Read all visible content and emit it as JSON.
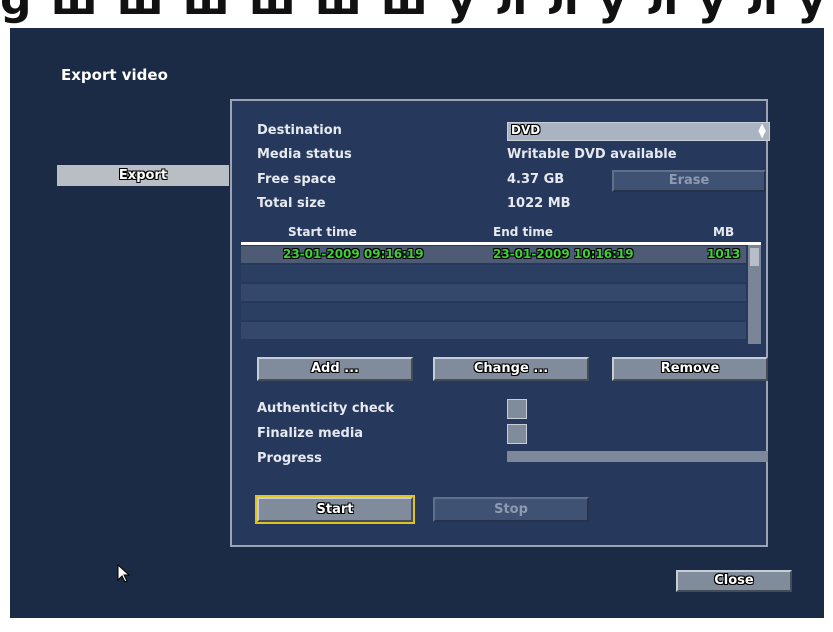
{
  "window": {
    "title": "Export video"
  },
  "sidebar": {
    "tab_label": "Export"
  },
  "form": {
    "destination_label": "Destination",
    "destination_value": "DVD",
    "media_status_label": "Media status",
    "media_status_value": "Writable DVD available",
    "free_space_label": "Free space",
    "free_space_value": "4.37 GB",
    "erase_label": "Erase",
    "total_size_label": "Total size",
    "total_size_value": "1022 MB"
  },
  "table": {
    "columns": [
      "Start time",
      "End time",
      "MB"
    ],
    "rows": [
      {
        "start": "23-01-2009 09:16:19",
        "end": "23-01-2009 10:16:19",
        "mb": "1013"
      }
    ]
  },
  "buttons": {
    "add": "Add ...",
    "change": "Change ...",
    "remove": "Remove",
    "start": "Start",
    "stop": "Stop",
    "close": "Close"
  },
  "options": {
    "authenticity_label": "Authenticity check",
    "finalize_label": "Finalize media",
    "progress_label": "Progress",
    "progress_value": 0
  },
  "colors": {
    "background": "#1b2a45",
    "panel": "#26395c",
    "highlight_text": "#3fcf36",
    "focus": "#e0c21d"
  }
}
